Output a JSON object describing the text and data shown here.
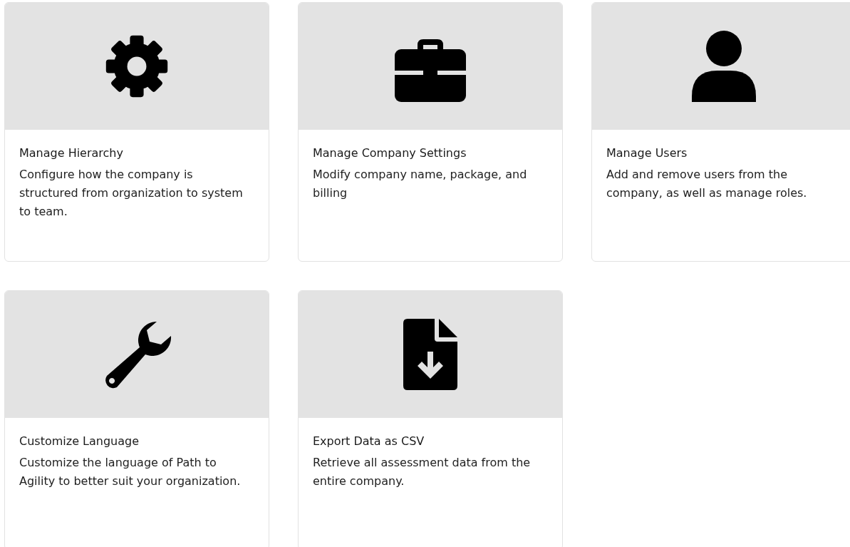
{
  "cards": [
    {
      "kind": "hierarchy",
      "title": "Manage Hierarchy",
      "description": "Configure how the company is structured from organization to system to team."
    },
    {
      "kind": "settings",
      "title": "Manage Company Settings",
      "description": "Modify company name, package, and billing"
    },
    {
      "kind": "users",
      "title": "Manage Users",
      "description": "Add and remove users from the company, as well as manage roles."
    },
    {
      "kind": "language",
      "title": "Customize Language",
      "description": "Customize the language of Path to Agility to better suit your organization."
    },
    {
      "kind": "export",
      "title": "Export Data as CSV",
      "description": "Retrieve all assessment data from the entire company."
    }
  ]
}
